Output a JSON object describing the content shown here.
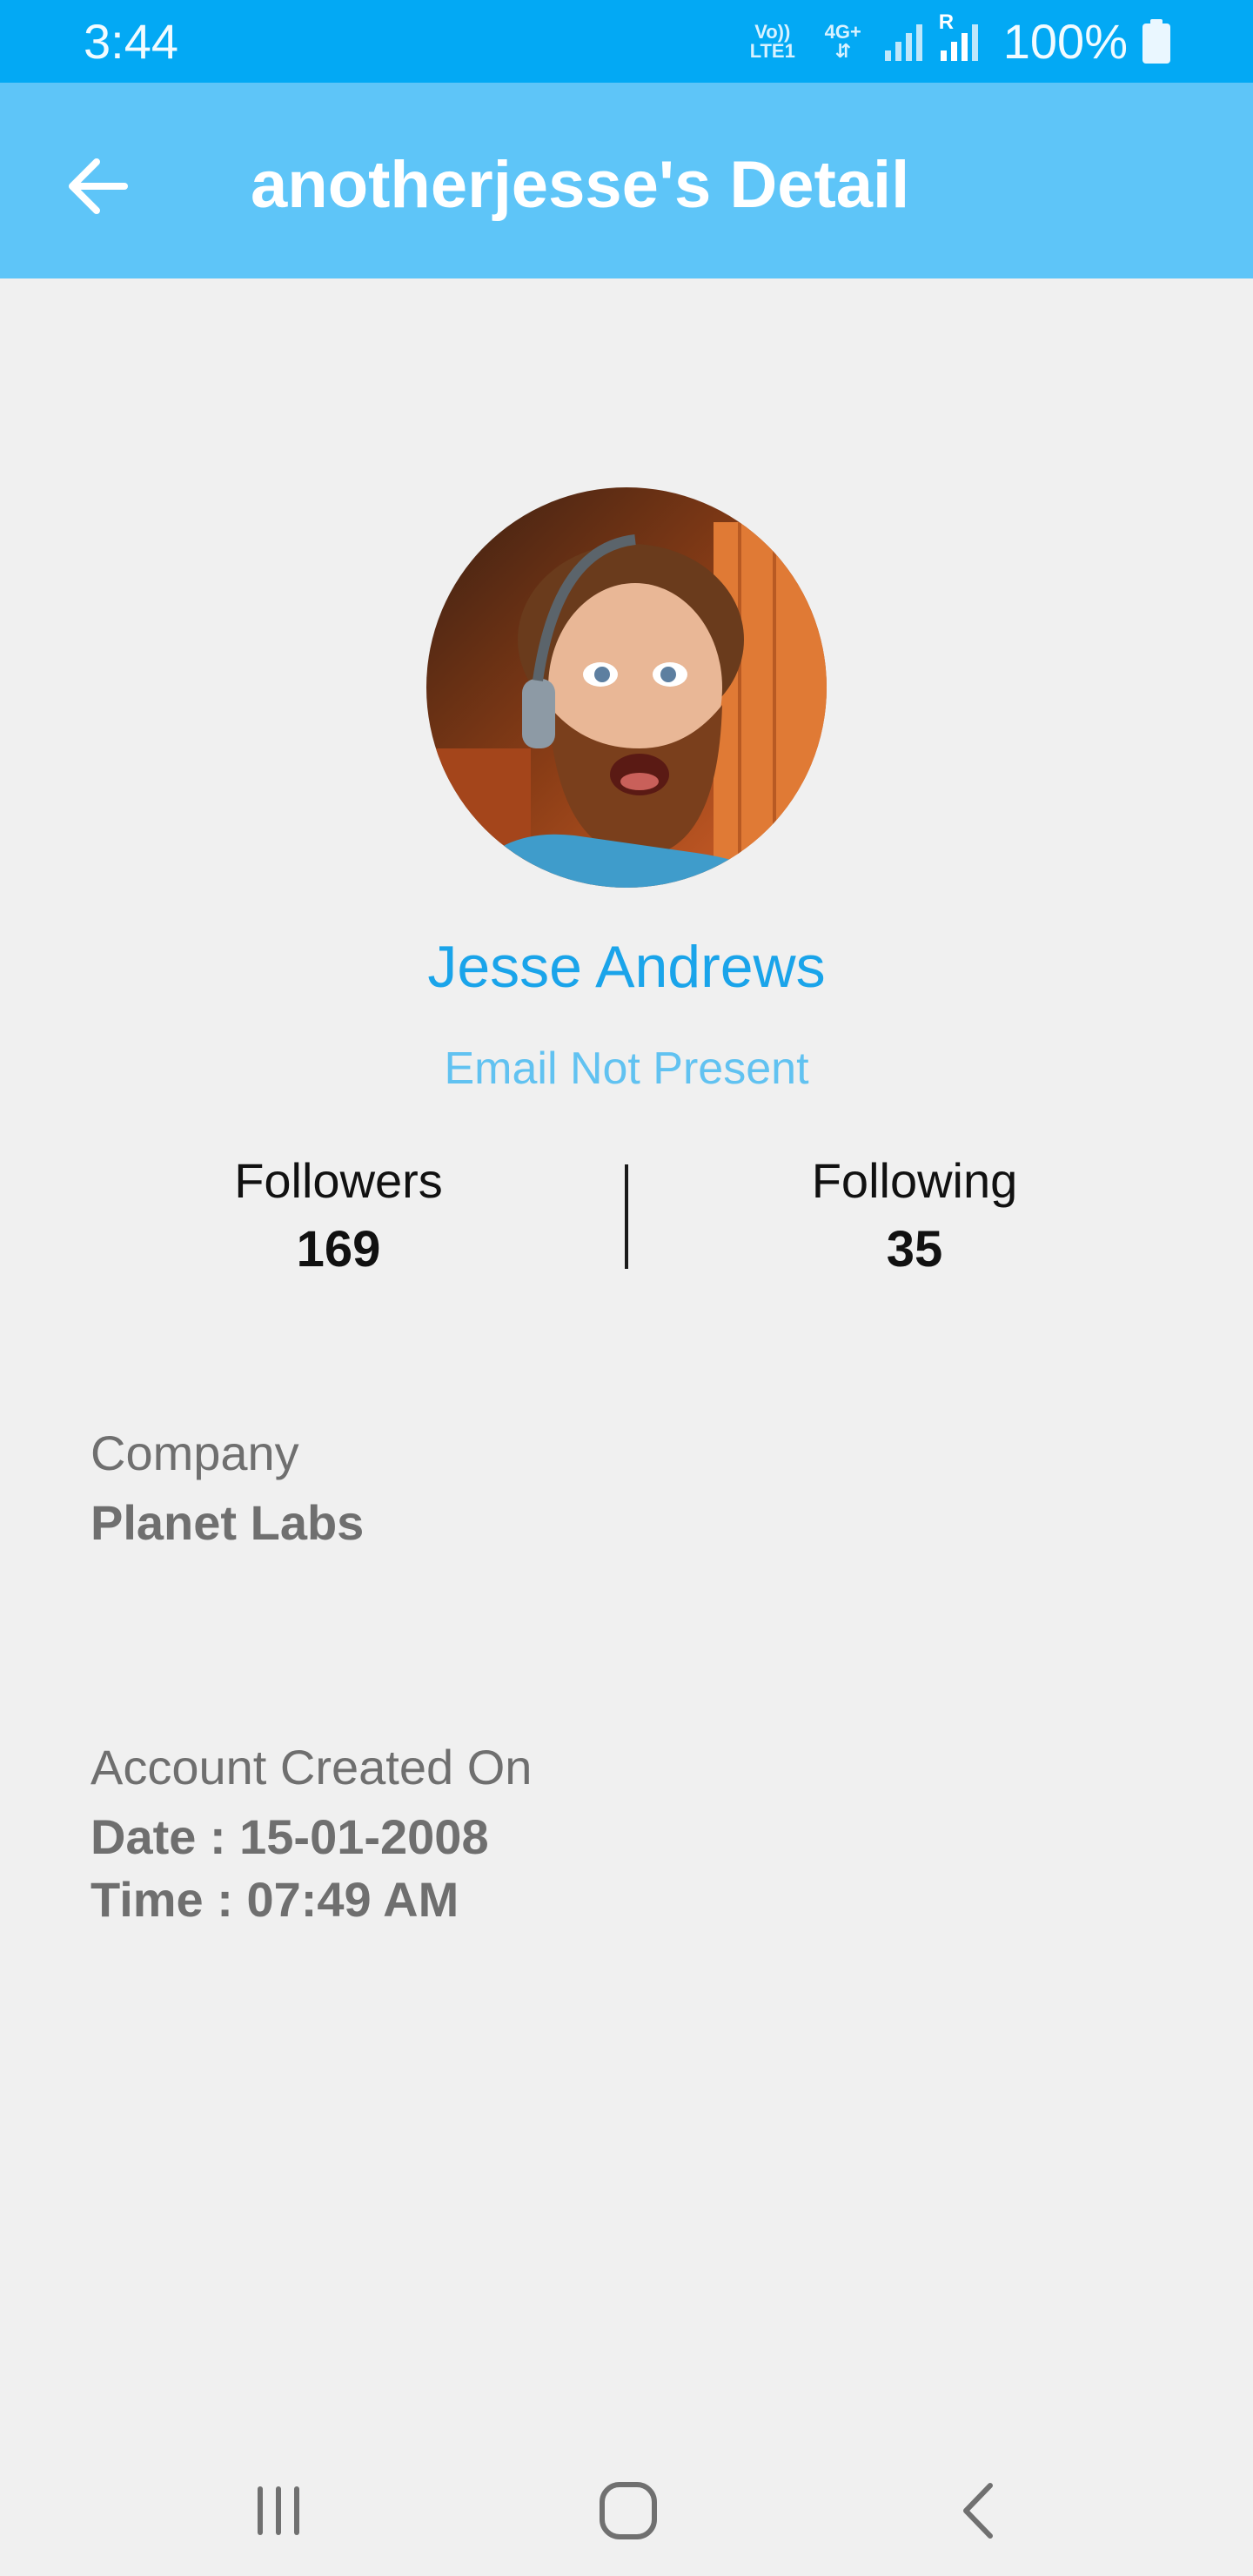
{
  "status_bar": {
    "time": "3:44",
    "net_volte": "Vo)) LTE1",
    "net_4g": "4G+",
    "roaming": "R",
    "battery": "100%"
  },
  "app_bar": {
    "back_icon": "arrow-left-icon",
    "title": "anotherjesse's Detail"
  },
  "profile": {
    "name": "Jesse Andrews",
    "email": "Email Not Present",
    "followers_label": "Followers",
    "followers_count": "169",
    "following_label": "Following",
    "following_count": "35"
  },
  "company": {
    "label": "Company",
    "value": "Planet Labs"
  },
  "account": {
    "label": "Account Created On",
    "date": "Date : 15-01-2008",
    "time": "Time : 07:49 AM"
  },
  "nav_bar": {
    "recent_icon": "recent-apps-icon",
    "home_icon": "home-icon",
    "back_icon": "back-chevron-icon"
  },
  "colors": {
    "status_bar": "#03a9f4",
    "app_bar": "#5ec5f8",
    "name": "#1aa4ea",
    "email": "#61c2f1",
    "background": "#f0f0f0"
  }
}
